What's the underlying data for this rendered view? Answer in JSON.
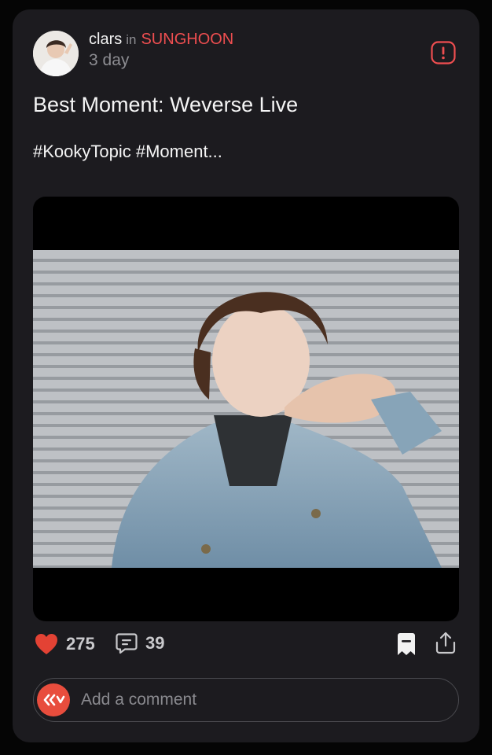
{
  "post": {
    "author": "clars",
    "in_label": "in",
    "community": "SUNGHOON",
    "time": "3 day",
    "title": "Best Moment: Weverse Live",
    "hashtags": "#KookyTopic #Moment..."
  },
  "actions": {
    "likes": "275",
    "comments": "39"
  },
  "comment_box": {
    "placeholder": "Add a comment"
  },
  "icons": {
    "report": "alert-icon",
    "like": "heart-icon",
    "comment": "comment-bubble-icon",
    "save": "bookmark-icon",
    "share": "share-icon",
    "app": "weverse-logo-icon"
  },
  "colors": {
    "accent": "#ee4e50",
    "card_bg": "#1c1b1f",
    "muted_text": "#8d8d92"
  }
}
